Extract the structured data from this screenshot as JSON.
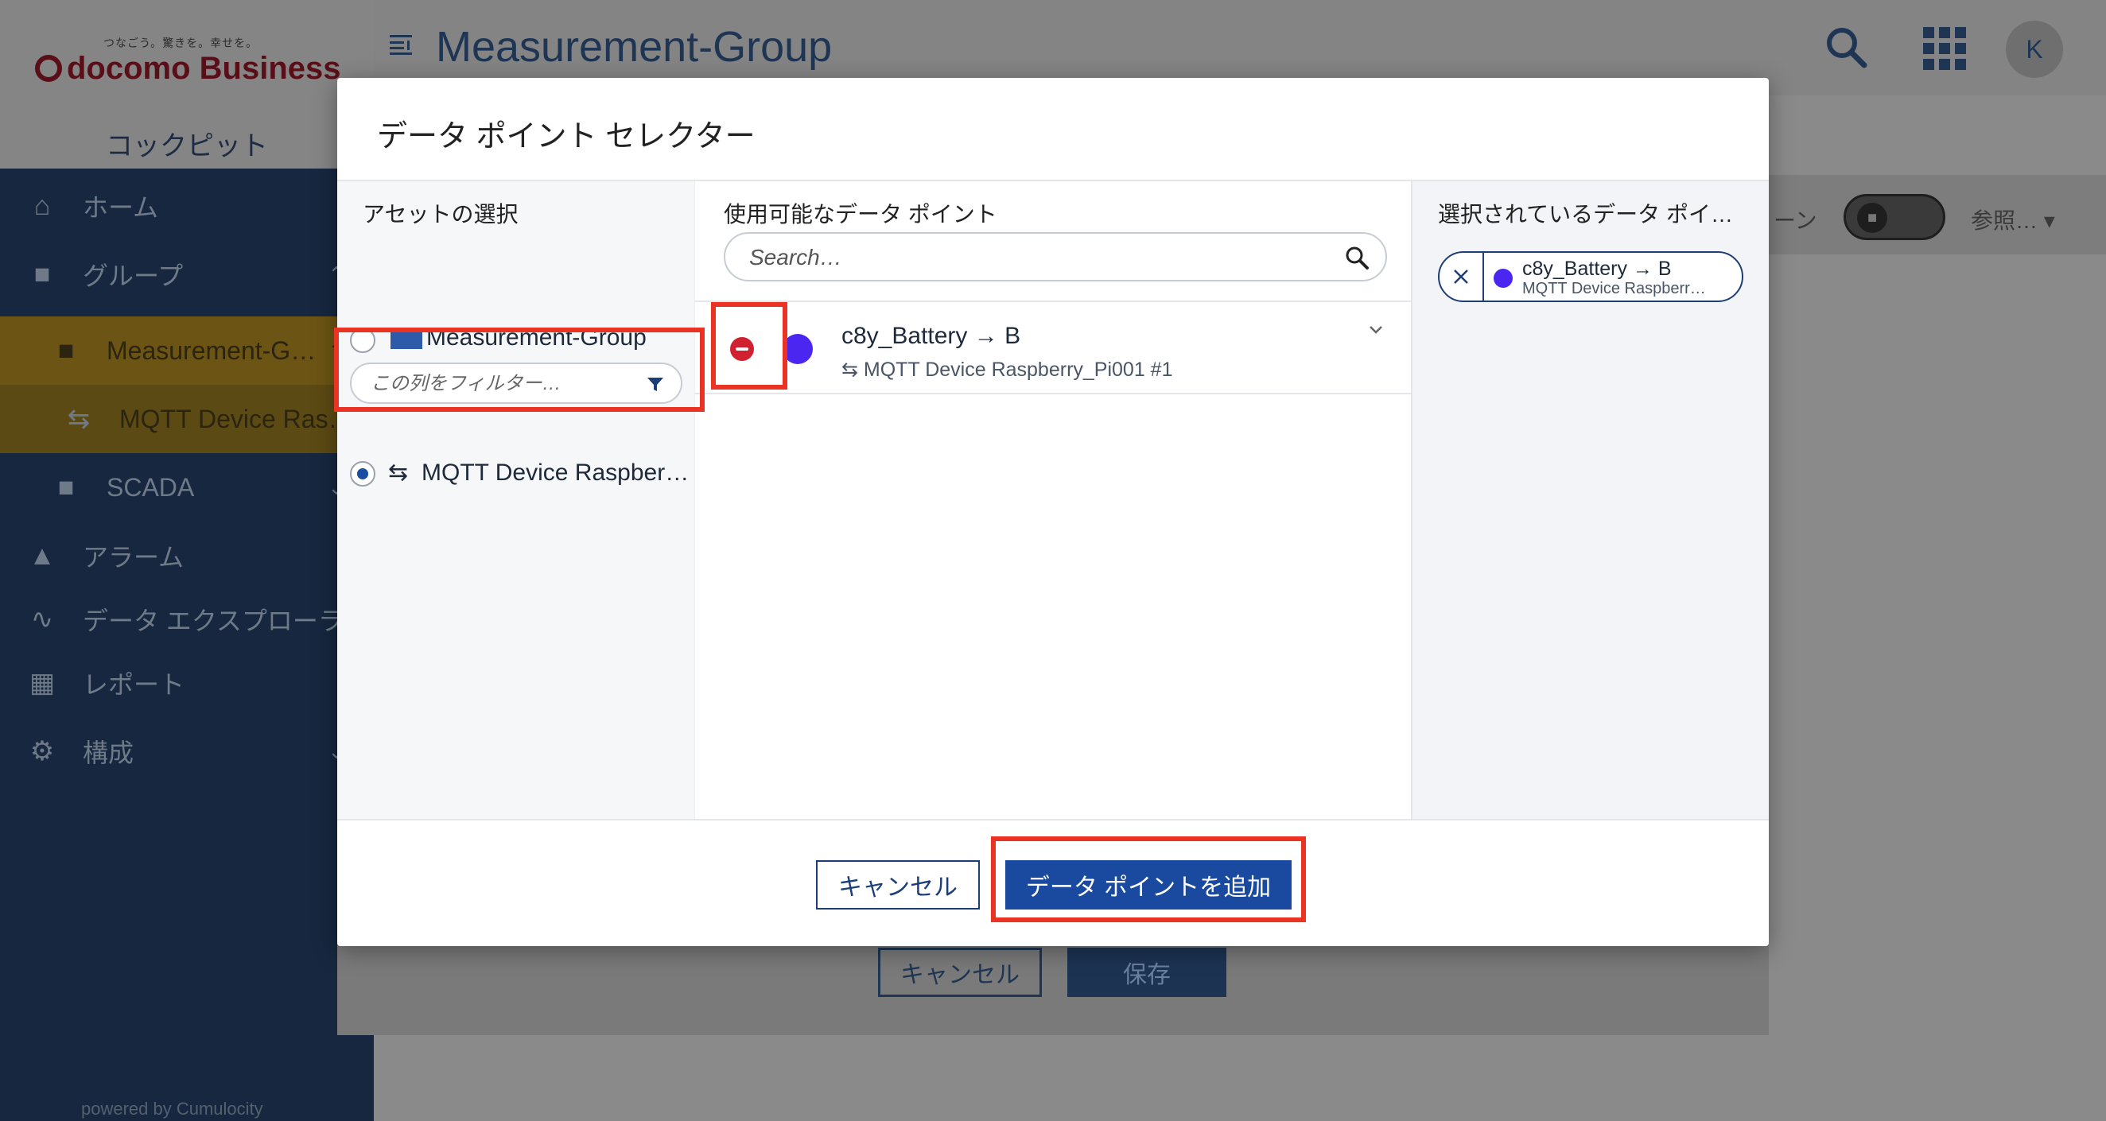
{
  "brand": {
    "tagline": "つなごう。驚きを。幸せを。",
    "name": "docomo Business",
    "app_name": "コックピット"
  },
  "sidebar": {
    "items": [
      {
        "label": "ホーム",
        "icon": "home-icon"
      },
      {
        "label": "グループ",
        "icon": "folder-icon"
      },
      {
        "label": "Measurement-G…",
        "icon": "folder-icon"
      },
      {
        "label": "MQTT Device Ras…",
        "icon": "device-icon"
      },
      {
        "label": "SCADA",
        "icon": "folder-icon"
      },
      {
        "label": "アラーム",
        "icon": "bell-icon"
      },
      {
        "label": "データ エクスプローラ",
        "icon": "data-explorer-icon"
      },
      {
        "label": "レポート",
        "icon": "report-icon"
      },
      {
        "label": "構成",
        "icon": "wrench-icon"
      }
    ],
    "footer": "powered by Cumulocity"
  },
  "header": {
    "title": "Measurement-Group",
    "avatar_initial": "K"
  },
  "toolbar": {
    "zone_label": "ーン",
    "ref_label": "参照…"
  },
  "background_form": {
    "cancel_label": "キャンセル",
    "save_label": "保存"
  },
  "modal": {
    "title": "データ ポイント セレクター",
    "asset_column": {
      "heading": "アセットの選択",
      "assets": [
        {
          "label": "Measurement-Group",
          "selected": false
        },
        {
          "label": "MQTT Device Raspber…",
          "selected": true
        }
      ],
      "filter_placeholder": "この列をフィルター…"
    },
    "available_column": {
      "heading": "使用可能なデータ ポイント",
      "search_placeholder": "Search…",
      "datapoints": [
        {
          "label": "c8y_Battery → B",
          "device": "MQTT Device Raspberry_Pi001 #1",
          "color": "#4b25f0"
        }
      ]
    },
    "selected_column": {
      "heading": "選択されているデータ ポイ…",
      "chips": [
        {
          "label": "c8y_Battery → B",
          "device": "MQTT Device Raspberr…",
          "color": "#4b25f0"
        }
      ]
    },
    "footer": {
      "cancel_label": "キャンセル",
      "add_label": "データ ポイントを追加"
    }
  },
  "colors": {
    "accent": "#1a4aa0",
    "highlight": "#ea3323",
    "remove": "#d1202f",
    "datapoint": "#4b25f0"
  }
}
